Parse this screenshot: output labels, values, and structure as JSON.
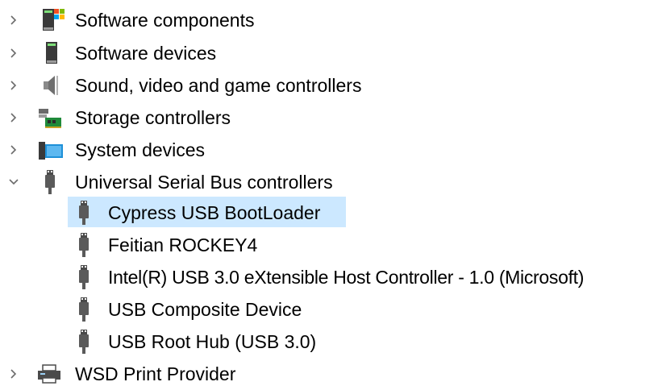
{
  "tree": {
    "items": [
      {
        "label": "Software components",
        "expander": "collapsed",
        "icon": "software-components-icon"
      },
      {
        "label": "Software devices",
        "expander": "collapsed",
        "icon": "software-devices-icon"
      },
      {
        "label": "Sound, video and game controllers",
        "expander": "collapsed",
        "icon": "speaker-icon"
      },
      {
        "label": "Storage controllers",
        "expander": "collapsed",
        "icon": "storage-controller-icon"
      },
      {
        "label": "System devices",
        "expander": "collapsed",
        "icon": "system-devices-icon"
      },
      {
        "label": "Universal Serial Bus controllers",
        "expander": "expanded",
        "icon": "usb-icon",
        "children": [
          {
            "label": "Cypress USB BootLoader",
            "icon": "usb-icon",
            "selected": true
          },
          {
            "label": "Feitian ROCKEY4",
            "icon": "usb-icon"
          },
          {
            "label": "Intel(R) USB 3.0 eXtensible Host Controller - 1.0 (Microsoft)",
            "icon": "usb-icon"
          },
          {
            "label": "USB Composite Device",
            "icon": "usb-icon"
          },
          {
            "label": "USB Root Hub (USB 3.0)",
            "icon": "usb-icon"
          }
        ]
      },
      {
        "label": "WSD Print Provider",
        "expander": "collapsed",
        "icon": "printer-icon"
      }
    ]
  },
  "colors": {
    "selection": "#cce8ff",
    "expander": "#6b6b6b",
    "text": "#000000"
  }
}
